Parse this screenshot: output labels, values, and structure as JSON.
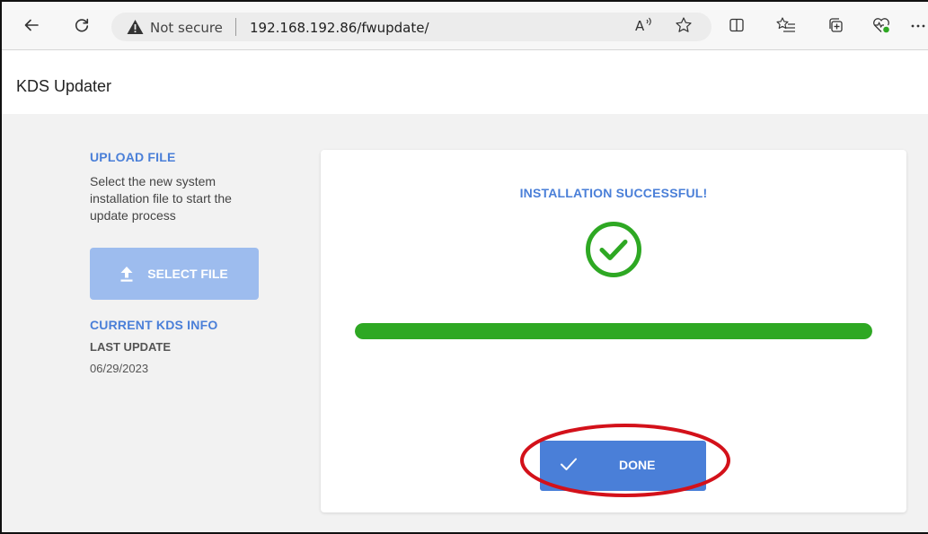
{
  "browser": {
    "security_label": "Not secure",
    "url": "192.168.192.86/fwupdate/",
    "icons": [
      "back-icon",
      "refresh-icon",
      "warning-icon",
      "read-aloud-icon",
      "favorite-star-icon",
      "split-screen-icon",
      "favorites-list-icon",
      "collections-icon",
      "browser-essentials-icon",
      "more-menu-icon"
    ]
  },
  "app": {
    "title": "KDS Updater"
  },
  "upload": {
    "title": "UPLOAD FILE",
    "description": "Select the new system installation file to start the update process",
    "select_button": "SELECT FILE"
  },
  "kds_info": {
    "title": "CURRENT KDS INFO",
    "last_update_label": "LAST UPDATE",
    "last_update_value": "06/29/2023"
  },
  "status": {
    "title": "INSTALLATION SUCCESSFUL!",
    "progress": 1.0,
    "done_button": "DONE"
  },
  "colors": {
    "accent": "#4a7fd8",
    "accent_disabled": "#9dbcee",
    "success": "#2ea823",
    "annotation": "#d3111a"
  }
}
